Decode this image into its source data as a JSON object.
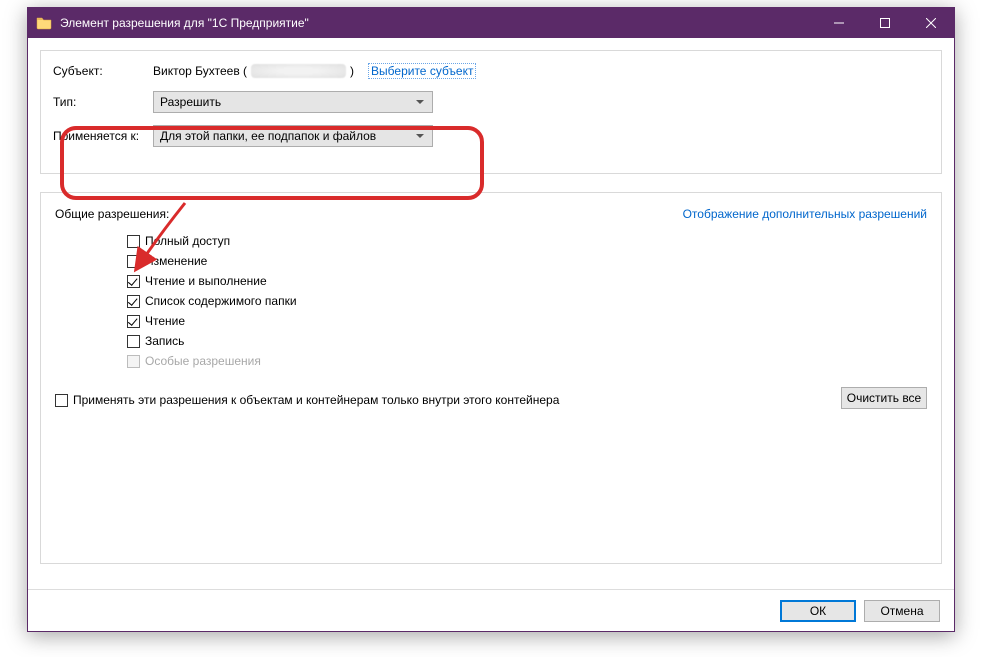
{
  "window": {
    "title": "Элемент разрешения для \"1С Предприятие\""
  },
  "subject": {
    "label": "Субъект:",
    "name": "Виктор Бухтеев (",
    "name_suffix": ")",
    "select_link": "Выберите субъект"
  },
  "type": {
    "label": "Тип:",
    "value": "Разрешить"
  },
  "applies": {
    "label": "Применяется к:",
    "value": "Для этой папки, ее подпапок и файлов"
  },
  "permissions": {
    "heading": "Общие разрешения:",
    "advanced_link": "Отображение дополнительных разрешений",
    "items": [
      {
        "label": "Полный доступ",
        "checked": false,
        "disabled": false
      },
      {
        "label": "Изменение",
        "checked": false,
        "disabled": false
      },
      {
        "label": "Чтение и выполнение",
        "checked": true,
        "disabled": false
      },
      {
        "label": "Список содержимого папки",
        "checked": true,
        "disabled": false
      },
      {
        "label": "Чтение",
        "checked": true,
        "disabled": false
      },
      {
        "label": "Запись",
        "checked": false,
        "disabled": false
      },
      {
        "label": "Особые разрешения",
        "checked": false,
        "disabled": true
      }
    ],
    "apply_only": "Применять эти разрешения к объектам и контейнерам только внутри этого контейнера",
    "clear_all": "Очистить все"
  },
  "buttons": {
    "ok": "ОК",
    "cancel": "Отмена"
  }
}
